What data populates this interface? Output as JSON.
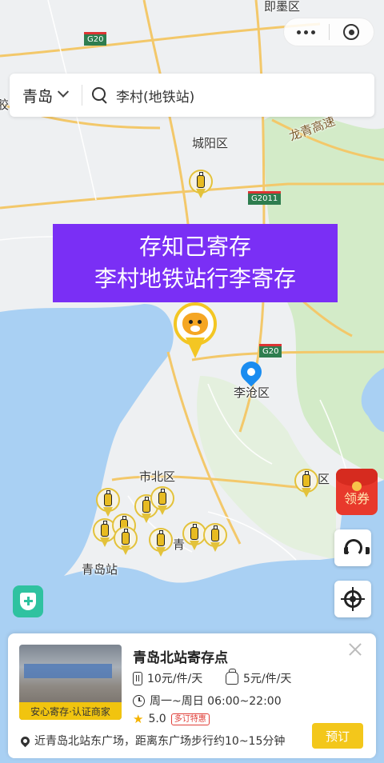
{
  "map": {
    "labels": {
      "jimo": "即墨区",
      "chengyang": "城阳区",
      "licang": "李沧区",
      "shibei": "市北区",
      "laoshan_part": "山区",
      "qingdao_station": "青岛站",
      "qingdao_part": "青",
      "longqing": "龙青高速",
      "left_edge": "胶",
      "road_g20_a": "G20",
      "road_g20_b": "G20",
      "road_g2011": "G2011"
    }
  },
  "capsule": {
    "more_icon": "more-dots-icon",
    "close_icon": "record-icon"
  },
  "search": {
    "city": "青岛",
    "query": "李村(地铁站)"
  },
  "banner": {
    "line1": "存知己寄存",
    "line2": "李村地铁站行李寄存"
  },
  "coupon": {
    "label": "领券"
  },
  "card": {
    "title": "青岛北站寄存点",
    "thumb_caption": "安心寄存·认证商家",
    "price_suitcase": "10元/件/天",
    "price_bag": "5元/件/天",
    "hours": "周一~周日 06:00~22:00",
    "rating": "5.0",
    "tag": "多订特惠",
    "address": "近青岛北站东广场，距离东广场步行约10~15分钟",
    "book_label": "预订"
  },
  "colors": {
    "accent": "#f3c71b",
    "banner": "#7a2ff5",
    "location_pin": "#1a8cf0",
    "coupon": "#e8392c",
    "shield": "#2fc2a0"
  }
}
